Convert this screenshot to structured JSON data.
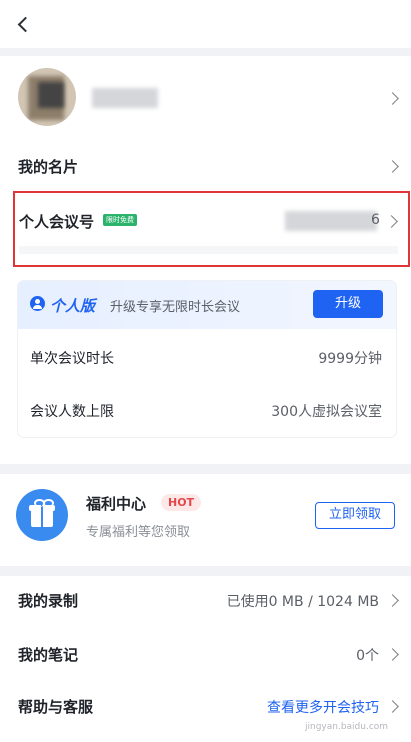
{
  "profile": {
    "name_masked": ""
  },
  "rows": {
    "card": {
      "label": "我的名片"
    },
    "meeting_id": {
      "label": "个人会议号",
      "badge": "限时免费",
      "value_suffix": "6"
    }
  },
  "plan": {
    "badge_label": "个人版",
    "promo": "升级专享无限时长会议",
    "upgrade_button": "升级",
    "items": [
      {
        "label": "单次会议时长",
        "value": "9999分钟"
      },
      {
        "label": "会议人数上限",
        "value": "300人虚拟会议室"
      }
    ]
  },
  "benefits": {
    "title": "福利中心",
    "hot": "HOT",
    "subtitle": "专属福利等您领取",
    "button": "立即领取"
  },
  "list": {
    "recording": {
      "label": "我的录制",
      "value": "已使用0 MB / 1024 MB"
    },
    "notes": {
      "label": "我的笔记",
      "value": "0个"
    },
    "help": {
      "label": "帮助与客服",
      "value": "查看更多开会技巧"
    }
  },
  "watermark": "jingyan.baidu.com",
  "colors": {
    "accent": "#1f63f2",
    "highlight_border": "#e0363a",
    "badge_green": "#2bb36b",
    "hot": "#e4474b"
  }
}
